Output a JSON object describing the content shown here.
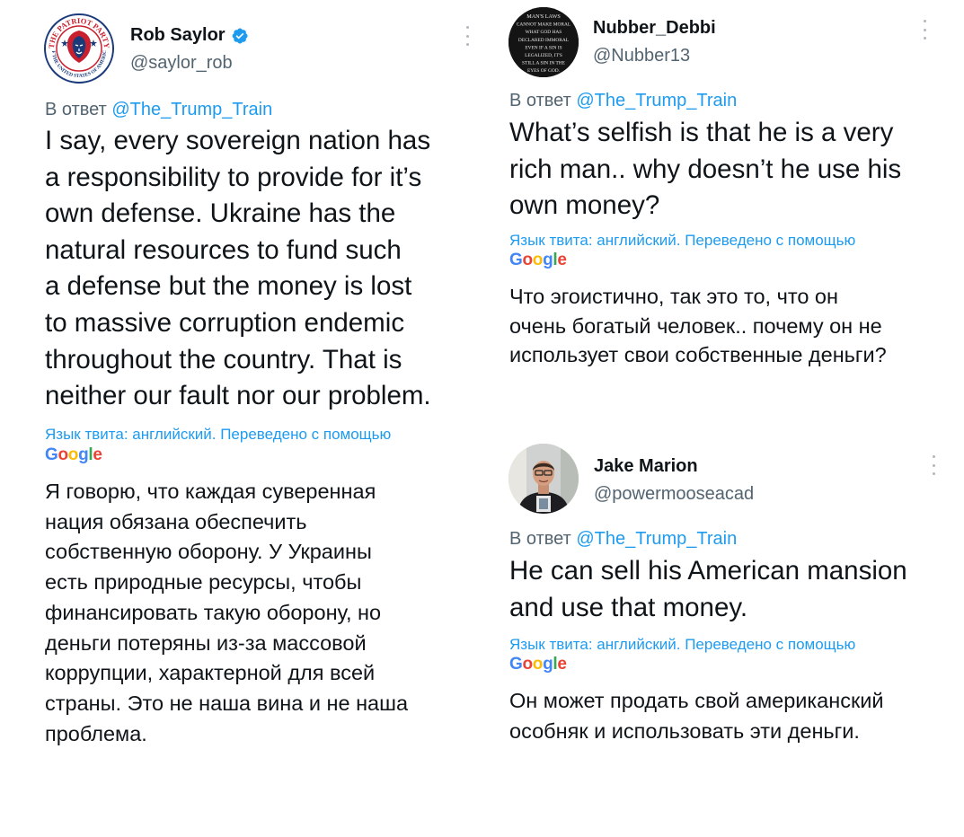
{
  "reply_prefix": "В ответ",
  "reply_target": "@The_Trump_Train",
  "lang_note": "Язык твита: английский. Переведено с помощью",
  "google_letters": [
    {
      "ch": "G",
      "color": "#4285F4"
    },
    {
      "ch": "o",
      "color": "#EA4335"
    },
    {
      "ch": "o",
      "color": "#FBBC05"
    },
    {
      "ch": "g",
      "color": "#4285F4"
    },
    {
      "ch": "l",
      "color": "#34A853"
    },
    {
      "ch": "e",
      "color": "#EA4335"
    }
  ],
  "tweets": [
    {
      "name": "Rob Saylor",
      "handle": "@saylor_rob",
      "verified": true,
      "avatar_text": "THE PATRIOT PARTY · OF THE UNITED STATES OF AMERICA",
      "text_lines": [
        "I say, every sovereign nation has",
        "a responsibility to provide for it’s",
        "own defense. Ukraine has the",
        "natural resources to fund such",
        "a defense but the money is lost",
        "to massive corruption endemic",
        "throughout the country. That is",
        "neither our fault nor our problem."
      ],
      "translation_lines": [
        "Я говорю, что каждая суверенная",
        "нация обязана обеспечить",
        "собственную оборону. У Украины",
        "есть природные ресурсы, чтобы",
        "финансировать такую оборону, но",
        "деньги потеряны из-за массовой",
        "коррупции, характерной для всей",
        "страны. Это не наша вина и не наша",
        "проблема."
      ]
    },
    {
      "name": "Nubber_Debbi",
      "handle": "@Nubber13",
      "verified": false,
      "avatar_lines": [
        "MAN'S LAWS",
        "CANNOT MAKE MORAL",
        "WHAT GOD HAS",
        "DECLARED IMMORAL",
        "EVEN IF A SIN IS",
        "LEGALIZED, IT'S",
        "STILL A SIN IN THE",
        "EYES OF GOD."
      ],
      "text_lines": [
        "What’s selfish is that he is a very",
        "rich man.. why doesn’t he use his",
        "own money?"
      ],
      "translation_lines": [
        "Что эгоистично, так это то, что он",
        "очень богатый человек.. почему он не",
        "использует свои собственные деньги?"
      ]
    },
    {
      "name": "Jake Marion",
      "handle": "@powermooseacad",
      "verified": false,
      "text_lines": [
        "He can sell his American mansion",
        "and use that money."
      ],
      "translation_lines": [
        "Он может продать свой американский",
        "особняк и использовать эти деньги."
      ]
    }
  ]
}
